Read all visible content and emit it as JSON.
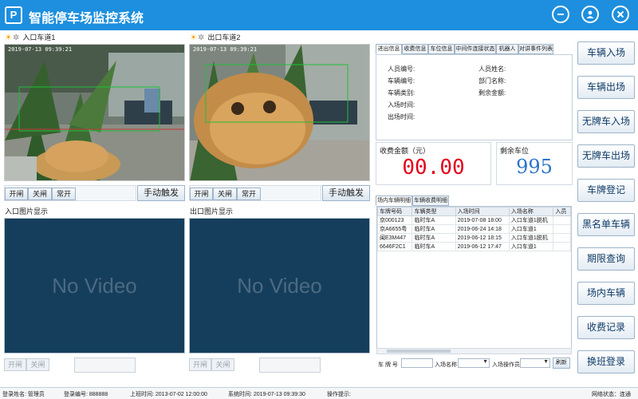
{
  "app": {
    "title": "智能停车场监控系统",
    "logo_text": "P"
  },
  "window_controls": {
    "minimize_icon": "minus-circle-icon",
    "user_icon": "user-circle-icon",
    "close_icon": "close-circle-icon"
  },
  "cameras": [
    {
      "title": "入口车道1",
      "timestamp": "2019-07-13  09:39:21"
    },
    {
      "title": "出口车道2",
      "timestamp": "2019-07-13  09:39:21"
    }
  ],
  "gate_controls": {
    "open": "开闸",
    "close": "关闸",
    "always_open": "常开",
    "manual_trigger": "手动触发"
  },
  "image_sections": {
    "entry": "入口图片显示",
    "exit": "出口图片显示",
    "no_video": "No Video"
  },
  "info_tabs": [
    "进出信息",
    "收费信息",
    "车位信息",
    "中间件连接状态",
    "机器人",
    "对讲事件列表"
  ],
  "info_fields": {
    "person_id": "人员编号:",
    "person_name": "人员姓名:",
    "vehicle_id": "车辆编号:",
    "department": "部门名称:",
    "vehicle_type": "车辆类别:",
    "balance": "剩余金额:",
    "entry_time": "入场时间:",
    "exit_time": "出场时间:"
  },
  "fee": {
    "label": "收费金额（元）",
    "value": "00.00"
  },
  "remaining": {
    "label": "剩余车位",
    "value": "995"
  },
  "grid_tabs": [
    "场内车辆明细",
    "车辆收费明细"
  ],
  "grid": {
    "columns": [
      "车牌号码",
      "车辆类型",
      "入场时间",
      "入场名称",
      "入员"
    ],
    "rows": [
      [
        "京000123",
        "临时车A",
        "2019-07-08 18:00",
        "入口车道1脱机",
        ""
      ],
      [
        "京A6655粤",
        "临时车A",
        "2019-06-24 14:18",
        "入口车道1",
        ""
      ],
      [
        "闽E3M447",
        "临时车A",
        "2019-06-12 18:15",
        "入口车道1脱机",
        ""
      ],
      [
        "6646F2C1",
        "临时车A",
        "2019-06-12 17:47",
        "入口车道1",
        ""
      ]
    ]
  },
  "filters": {
    "plate_label": "车 牌 号",
    "entry_name_label": "入场名称",
    "operator_label": "入场操作员",
    "refresh": "刷新"
  },
  "side_buttons": [
    "车辆入场",
    "车辆出场",
    "无牌车入场",
    "无牌车出场",
    "车牌登记",
    "黑名单车辆",
    "期限查询",
    "场内车辆",
    "收费记录",
    "换班登录"
  ],
  "status_bar": {
    "user_name": "登录姓名: 管理员",
    "user_id": "登录编号: 888888",
    "shift_time": "上班时间: 2013-07-02 12:00:00",
    "system_time": "系统时间: 2019-07-13 09:39:30",
    "op_hint": "操作提示:",
    "network": "网络状态：连通"
  },
  "colors": {
    "titlebar": "#1d8fde",
    "fee_value": "#e4001b",
    "remaining_value": "#2c74c9",
    "no_video_bg": "#153e5c"
  }
}
